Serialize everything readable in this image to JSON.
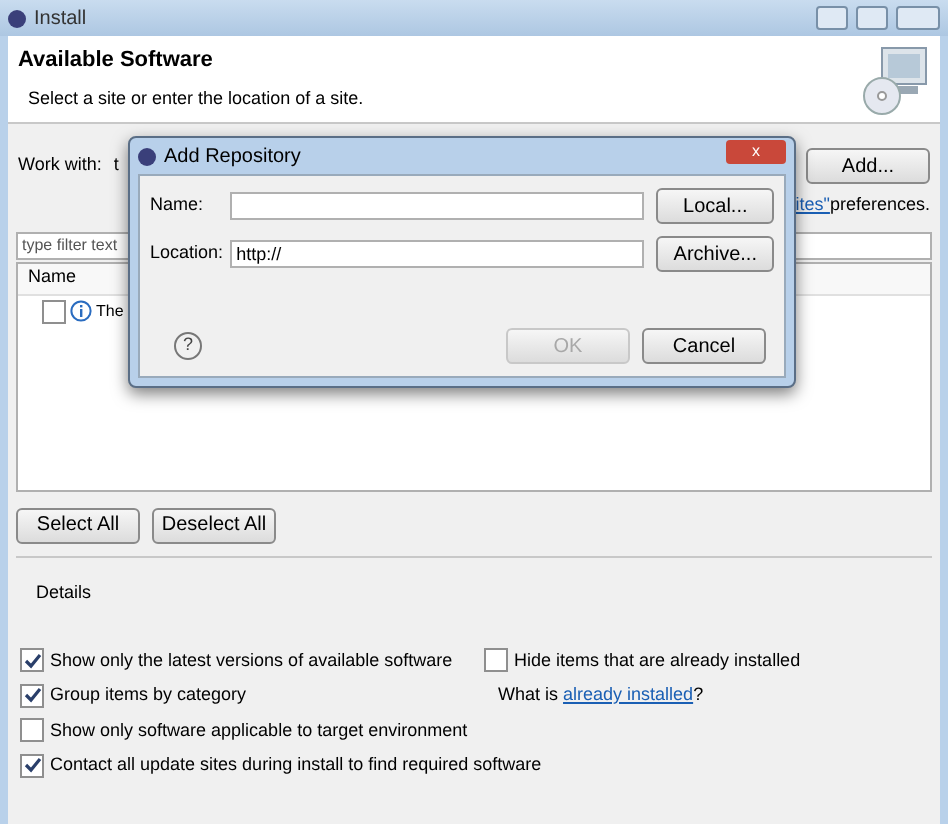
{
  "window": {
    "title": "Install"
  },
  "header": {
    "title": "Available Software",
    "subtitle": "Select a site or enter the location of a site."
  },
  "work_with": {
    "label": "Work with:",
    "value": "t",
    "add_button": "Add...",
    "link_text": "ites\"",
    "link_suffix": " preferences."
  },
  "filter": {
    "placeholder": "type filter text"
  },
  "table": {
    "columns": [
      "Name"
    ],
    "rows": [
      {
        "checked": false,
        "text": "The"
      }
    ]
  },
  "table_buttons": [
    "Select All",
    "Deselect All"
  ],
  "details": {
    "label": "Details"
  },
  "options": [
    {
      "label": "Show only the latest versions of available software",
      "checked": true
    },
    {
      "label": "Group items by category",
      "checked": true
    },
    {
      "label": "Show only software applicable to target environment",
      "checked": false
    },
    {
      "label": "Contact all update sites during install to find required software",
      "checked": true
    }
  ],
  "hide_installed": {
    "label": "Hide items that are already installed",
    "checked": false
  },
  "what_is": {
    "prefix": "What is ",
    "link": "already installed",
    "suffix": "?"
  },
  "dialog": {
    "title": "Add Repository",
    "close": "x",
    "fields": [
      {
        "label": "Name:",
        "button": "Local..."
      },
      {
        "label": "Location:",
        "value": "http://",
        "button": "Archive..."
      }
    ],
    "help": "?",
    "ok": {
      "label": "OK",
      "disabled": true
    },
    "cancel": {
      "label": "Cancel",
      "disabled": false
    }
  }
}
